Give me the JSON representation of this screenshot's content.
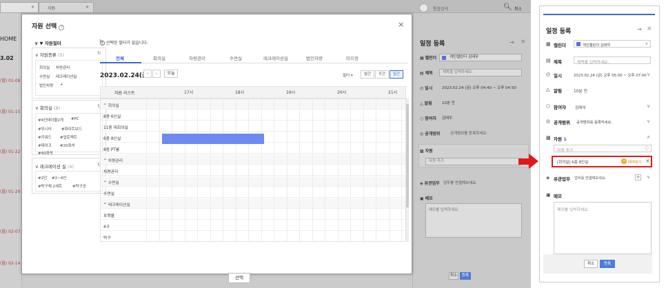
{
  "background": {
    "tabs": [
      {
        "label": "× "
      },
      {
        "label": "자원"
      }
    ],
    "tab_close": "×",
    "home": "HOME",
    "date_num": "3.02",
    "dates": [
      "(월) 01-08",
      "(월) 01-15",
      "(월) 01-22",
      "(월) 01-29",
      "(월) 02-07",
      "(월) 02-14"
    ],
    "search_placeholder": "통합검색",
    "search_scope": "취소",
    "panel_title": "일정 등록",
    "calendar_value": "개인캘린더 김태우",
    "title_placeholder": "제목을 입력하세요.",
    "datetime_value": "2023.02.24 (금) 오후 04:40 ~ 오후 04:50",
    "alarm_value": "10분 전",
    "attendee_value": "김태우",
    "scope_value": "공개범위를 등록하세요.",
    "resource_placeholder": "자원 추가",
    "related_value": "업무를 연결해보세요.",
    "memo_placeholder": "메모를 입력하세요.",
    "labels": {
      "calendar": "캘린더",
      "title": "제목",
      "datetime": "일시",
      "alarm": "알림",
      "attendee": "참여자",
      "scope": "공개범위",
      "resource": "자원",
      "related": "유관업무",
      "memo": "메모"
    },
    "cancel": "취소",
    "register": "등록"
  },
  "modal": {
    "title": "자원 선택",
    "help_icon": "?",
    "close": "×",
    "filter": {
      "header": "자원필터",
      "groups": [
        {
          "name": "자원종류",
          "count": "(5)",
          "items": [
            "회의실",
            "차량관리",
            "수면실",
            "레크레이션실",
            "법인차량",
            "+"
          ]
        },
        {
          "name": "회의실",
          "count": "(8)",
          "items": [
            "#4인테이블2개",
            "#PC",
            "#모니터",
            "#화이트보드",
            "#키워드",
            "#업로젝트",
            "#테이크",
            "#20좌석",
            "#40좌석"
          ]
        },
        {
          "name": "레크레이션 실",
          "count": "(4)",
          "items": [
            "#2인",
            "#2~4인",
            "#탁구채 2세트",
            "#탁구공"
          ]
        }
      ]
    },
    "notice": "선택된 필터가 없습니다.",
    "tabs": [
      "전체",
      "회의실",
      "차량관리",
      "수면실",
      "레크레이션실",
      "법인차량",
      "미지정"
    ],
    "date": "2023.02.24(금)",
    "today": "오늘",
    "filter_drop": "필터 ▾",
    "views": [
      "월간",
      "주간",
      "일간"
    ],
    "grid_header": "자원 리스트",
    "times": [
      "17시",
      "18시",
      "19시",
      "20시",
      "21시"
    ],
    "rows": [
      {
        "label": "^ 회의실",
        "group": true
      },
      {
        "label": "8층 6인실",
        "group": false
      },
      {
        "label": "11층 대회의실",
        "group": false
      },
      {
        "label": "6층 8인실",
        "group": false
      },
      {
        "label": "8층 PT룸",
        "group": false
      },
      {
        "label": "^ 차량관리",
        "group": true
      },
      {
        "label": "차량관리",
        "group": false
      },
      {
        "label": "^ 수면실",
        "group": true
      },
      {
        "label": "수면실",
        "group": false
      },
      {
        "label": "^ 레크레이션실",
        "group": true
      },
      {
        "label": "포켓볼",
        "group": false
      },
      {
        "label": "4구",
        "group": false
      },
      {
        "label": "탁구",
        "group": false
      }
    ],
    "select_btn": "선택"
  },
  "right_panel": {
    "title": "일정 등록",
    "labels": {
      "calendar": "캘린더",
      "title": "제목",
      "datetime": "일시",
      "alarm": "알림",
      "attendee": "참여자",
      "scope": "공개범위",
      "resource": "자원",
      "related": "유관업무",
      "memo": "메모"
    },
    "resource_count": "1",
    "calendar_value": "개인캘린더 김태우",
    "title_placeholder": "제목을 입력하세요.",
    "datetime_value": "2023.02.24 (금) 오후 05:00 ~ 오후 07:00",
    "alarm_value": "10분 전",
    "attendee_value": "김태우",
    "scope_value": "공개범위를 등록하세요.",
    "resource_placeholder": "자원 추가",
    "resource_item": "[회의실] 6층 8인실",
    "resource_status": "예약대기",
    "related_value": "업무를 연결해보세요.",
    "memo_placeholder": "메모를 입력하세요.",
    "cancel": "취소",
    "register": "등록"
  },
  "colors": {
    "accent": "#3a66d8",
    "booking": "#6e89f0",
    "highlight": "#e01818",
    "pending": "#f0a020"
  }
}
